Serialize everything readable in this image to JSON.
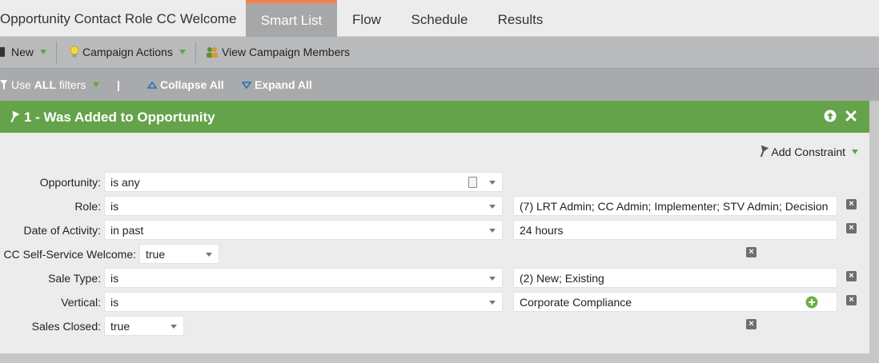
{
  "header": {
    "title": "Opportunity Contact Role CC Welcome",
    "tabs": [
      {
        "label": "Smart List",
        "active": true
      },
      {
        "label": "Flow",
        "active": false
      },
      {
        "label": "Schedule",
        "active": false
      },
      {
        "label": "Results",
        "active": false
      }
    ],
    "accent_color": "#f2834a"
  },
  "toolbar": {
    "new_label": "New",
    "campaign_actions_label": "Campaign Actions",
    "view_members_label": "View Campaign Members"
  },
  "filterbar": {
    "use_prefix": "Use ",
    "use_all": "ALL",
    "use_suffix": " filters",
    "divider": "|",
    "collapse_label": "Collapse All",
    "expand_label": "Expand All"
  },
  "filter": {
    "title": "1 - Was Added to Opportunity",
    "header_color": "#65a34a",
    "add_constraint_label": "Add Constraint",
    "constraints": [
      {
        "label": "Opportunity:",
        "operator": "is any",
        "value": ""
      },
      {
        "label": "Role:",
        "operator": "is",
        "value": "(7) LRT Admin; CC Admin; Implementer; STV Admin; Decision"
      },
      {
        "label": "Date of Activity:",
        "operator": "in past",
        "value": "24 hours"
      },
      {
        "label": "CC Self-Service Welcome:",
        "operator": "true",
        "value": ""
      },
      {
        "label": "Sale Type:",
        "operator": "is",
        "value": "(2) New; Existing"
      },
      {
        "label": "Vertical:",
        "operator": "is",
        "value": "Corporate Compliance"
      },
      {
        "label": "Sales Closed:",
        "operator": "true",
        "value": ""
      }
    ]
  },
  "icons": {
    "delete": "close-x-icon",
    "add": "plus-circle-icon",
    "funnel": "funnel-icon"
  }
}
